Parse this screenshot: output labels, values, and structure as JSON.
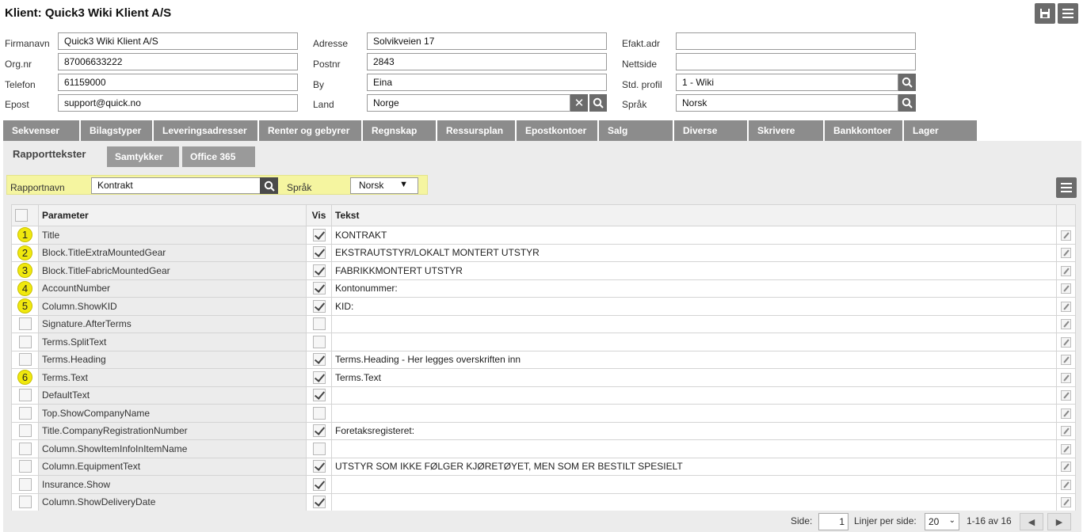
{
  "header": {
    "title": "Klient: Quick3 Wiki Klient A/S",
    "save_icon": "save-icon",
    "menu_icon": "hamburger-menu-icon"
  },
  "form": {
    "firmanavn_label": "Firmanavn",
    "firmanavn_value": "Quick3 Wiki Klient A/S",
    "orgnr_label": "Org.nr",
    "orgnr_value": "87006633222",
    "telefon_label": "Telefon",
    "telefon_value": "61159000",
    "epost_label": "Epost",
    "epost_value": "support@quick.no",
    "adresse_label": "Adresse",
    "adresse_value": "Solvikveien 17",
    "postnr_label": "Postnr",
    "postnr_value": "2843",
    "by_label": "By",
    "by_value": "Eina",
    "land_label": "Land",
    "land_value": "Norge",
    "efakt_label": "Efakt.adr",
    "efakt_value": "",
    "nettside_label": "Nettside",
    "nettside_value": "",
    "profil_label": "Std. profil",
    "profil_value": "1 - Wiki",
    "sprak_label": "Språk",
    "sprak_value": "Norsk"
  },
  "tabs_main": [
    "Sekvenser",
    "Bilagstyper",
    "Leveringsadresser",
    "Renter og gebyrer",
    "Regnskap",
    "Ressursplan",
    "Epostkontoer",
    "Salg",
    "Diverse",
    "Skrivere",
    "Bankkontoer",
    "Lager"
  ],
  "tabs_sub": [
    "Rapporttekster",
    "Samtykker",
    "Office 365"
  ],
  "filter": {
    "rapportnavn_label": "Rapportnavn",
    "rapportnavn_value": "Kontrakt",
    "sprak_label": "Språk",
    "sprak_value": "Norsk"
  },
  "grid": {
    "columns": {
      "parameter": "Parameter",
      "vis": "Vis",
      "tekst": "Tekst"
    },
    "rows": [
      {
        "badge": "1",
        "parameter": "Title",
        "vis": true,
        "tekst": "KONTRAKT"
      },
      {
        "badge": "2",
        "parameter": "Block.TitleExtraMountedGear",
        "vis": true,
        "tekst": "EKSTRAUTSTYR/LOKALT MONTERT UTSTYR"
      },
      {
        "badge": "3",
        "parameter": "Block.TitleFabricMountedGear",
        "vis": true,
        "tekst": "FABRIKKMONTERT UTSTYR"
      },
      {
        "badge": "4",
        "parameter": "AccountNumber",
        "vis": true,
        "tekst": "Kontonummer:"
      },
      {
        "badge": "5",
        "parameter": "Column.ShowKID",
        "vis": true,
        "tekst": "KID:"
      },
      {
        "badge": "",
        "parameter": "Signature.AfterTerms",
        "vis": false,
        "tekst": ""
      },
      {
        "badge": "",
        "parameter": "Terms.SplitText",
        "vis": false,
        "tekst": ""
      },
      {
        "badge": "",
        "parameter": "Terms.Heading",
        "vis": true,
        "tekst": "Terms.Heading - Her legges overskriften inn"
      },
      {
        "badge": "6",
        "parameter": "Terms.Text",
        "vis": true,
        "tekst": "Terms.Text"
      },
      {
        "badge": "",
        "parameter": "DefaultText",
        "vis": true,
        "tekst": ""
      },
      {
        "badge": "",
        "parameter": "Top.ShowCompanyName",
        "vis": false,
        "tekst": ""
      },
      {
        "badge": "",
        "parameter": "Title.CompanyRegistrationNumber",
        "vis": true,
        "tekst": "Foretaksregisteret:"
      },
      {
        "badge": "",
        "parameter": "Column.ShowItemInfoInItemName",
        "vis": false,
        "tekst": ""
      },
      {
        "badge": "",
        "parameter": "Column.EquipmentText",
        "vis": true,
        "tekst": "UTSTYR SOM IKKE FØLGER KJØRETØYET, MEN SOM ER BESTILT SPESIELT"
      },
      {
        "badge": "",
        "parameter": "Insurance.Show",
        "vis": true,
        "tekst": ""
      },
      {
        "badge": "",
        "parameter": "Column.ShowDeliveryDate",
        "vis": true,
        "tekst": ""
      }
    ]
  },
  "pager": {
    "side_label": "Side:",
    "side_value": "1",
    "linjer_label": "Linjer per side:",
    "linjer_value": "20",
    "range": "1-16 av 16"
  }
}
